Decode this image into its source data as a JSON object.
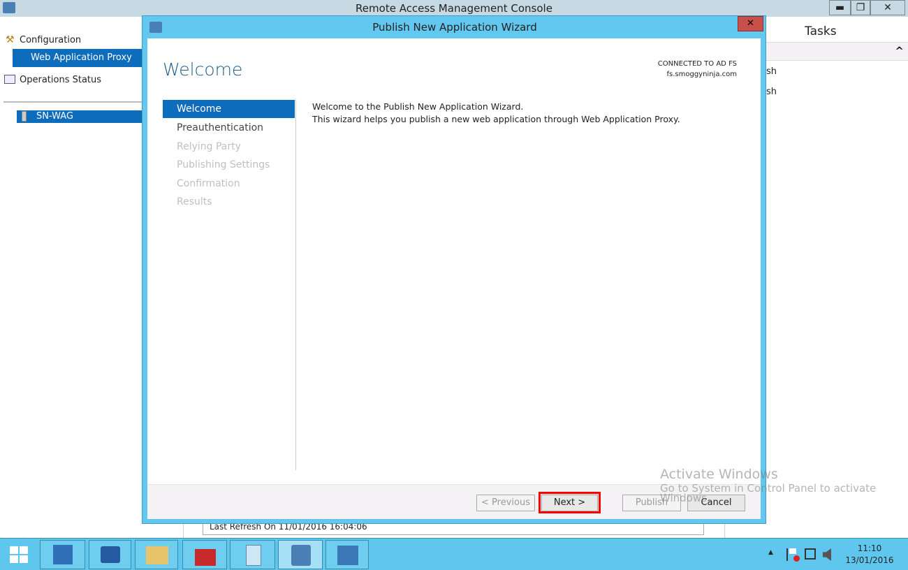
{
  "main": {
    "title": "Remote Access Management Console",
    "minimize": "▬",
    "restore": "❐",
    "close": "✕"
  },
  "tree": {
    "configuration": "Configuration",
    "wap": "Web Application Proxy",
    "ops": "Operations Status",
    "server": "SN-WAG"
  },
  "tasks": {
    "title": "Tasks",
    "collapse": "^",
    "items": [
      "sh",
      "sh"
    ]
  },
  "status": {
    "last_refresh": "Last Refresh On 11/01/2016 16:04:06"
  },
  "dialog": {
    "title": "Publish New Application Wizard",
    "close": "✕",
    "heading": "Welcome",
    "connected_label": "CONNECTED TO AD FS",
    "connected_server": "fs.smoggyninja.com",
    "nav": [
      "Welcome",
      "Preauthentication",
      "Relying Party",
      "Publishing Settings",
      "Confirmation",
      "Results"
    ],
    "body_line1": "Welcome to the Publish New Application Wizard.",
    "body_line2": "This wizard helps you publish a new web application through Web Application Proxy.",
    "buttons": {
      "previous": "< Previous",
      "next": "Next >",
      "publish": "Publish",
      "cancel": "Cancel"
    },
    "highlight_color": "#ff0000"
  },
  "watermark": {
    "title": "Activate Windows",
    "line1": "Go to System in Control Panel to activate",
    "line2": "Windows."
  },
  "taskbar": {
    "time": "11:10",
    "date": "13/01/2016",
    "tray_arrow": "▲"
  }
}
